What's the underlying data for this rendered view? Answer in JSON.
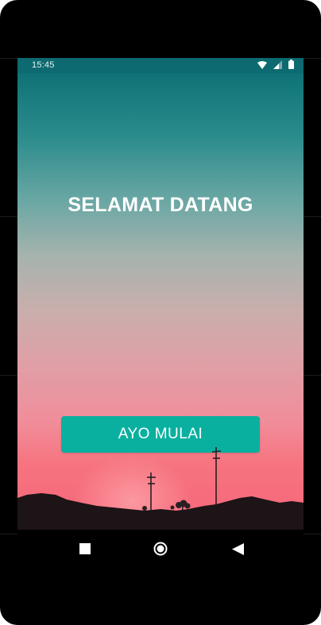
{
  "status_bar": {
    "time": "15:45"
  },
  "main": {
    "title": "SELAMAT DATANG",
    "start_button_label": "AYO MULAI"
  },
  "nav_bar": {
    "icons": [
      "recent-apps-icon",
      "home-icon",
      "back-icon"
    ]
  },
  "colors": {
    "status_bar": "#0c6a70",
    "button": "#0ab09f",
    "gradient_top": "#0e7276",
    "gradient_bottom": "#f7667a"
  }
}
